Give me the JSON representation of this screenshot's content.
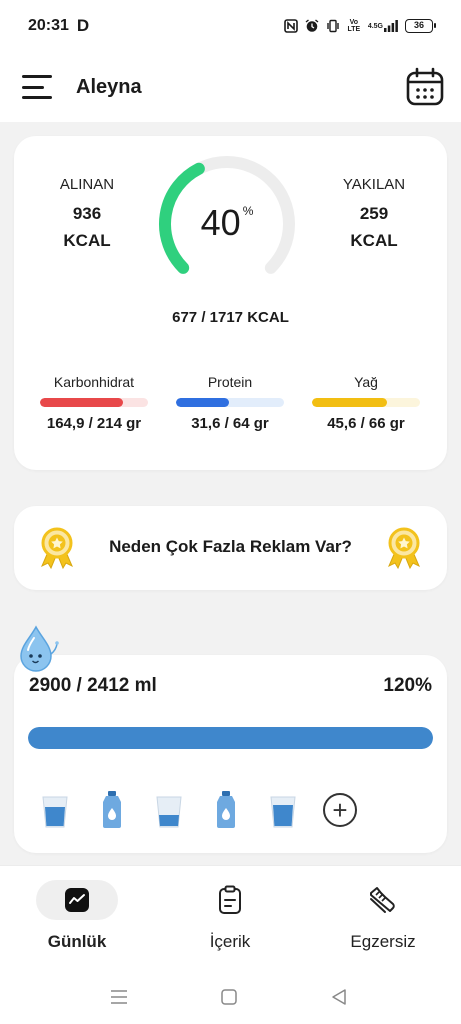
{
  "status_bar": {
    "time": "20:31",
    "carrier_logo": "D",
    "volte": "Vo LTE",
    "network": "4.5G",
    "battery": "36",
    "icons": [
      "nfc-icon",
      "alarm-icon",
      "vibrate-icon",
      "volte-icon",
      "signal-icon",
      "battery-icon"
    ]
  },
  "header": {
    "user_name": "Aleyna",
    "menu_icon": "hamburger-menu-icon",
    "calendar_icon": "calendar-icon"
  },
  "summary": {
    "taken_label": "ALINAN",
    "taken_value": "936",
    "taken_unit": "KCAL",
    "burned_label": "YAKILAN",
    "burned_value": "259",
    "burned_unit": "KCAL",
    "percent": "40",
    "percent_sign": "%",
    "percent_value": 0.4,
    "kcal_total": "677 / 1717 KCAL",
    "gauge_color": "#2fd07e",
    "gauge_track_color": "#ededed"
  },
  "macros": [
    {
      "label": "Karbonhidrat",
      "value": "164,9 / 214 gr",
      "fraction": 0.77,
      "color": "#e8484a",
      "track": "#fbe3e3"
    },
    {
      "label": "Protein",
      "value": "31,6 / 64 gr",
      "fraction": 0.49,
      "color": "#2f6fe0",
      "track": "#e2edfb"
    },
    {
      "label": "Yağ",
      "value": "45,6 / 66 gr",
      "fraction": 0.69,
      "color": "#f2be12",
      "track": "#fcf5dc"
    }
  ],
  "ad": {
    "text": "Neden Çok Fazla Reklam Var?",
    "badge_icon": "award-badge-icon"
  },
  "water": {
    "amount": "2900 / 2412 ml",
    "percent": "120%",
    "fill_fraction": 1.0,
    "bar_color": "#3f87cc",
    "mascot_icon": "water-drop-mascot-icon",
    "items": [
      "glass",
      "bottle",
      "glass",
      "bottle",
      "glass"
    ],
    "add_label": "+"
  },
  "bottom_nav": {
    "items": [
      {
        "label": "Günlük",
        "icon": "trend-chart-icon",
        "active": true
      },
      {
        "label": "İçerik",
        "icon": "clipboard-icon",
        "active": false
      },
      {
        "label": "Egzersiz",
        "icon": "sneaker-icon",
        "active": false
      }
    ]
  },
  "system_nav": {
    "icons": [
      "recent-apps-icon",
      "home-icon",
      "back-icon"
    ]
  }
}
